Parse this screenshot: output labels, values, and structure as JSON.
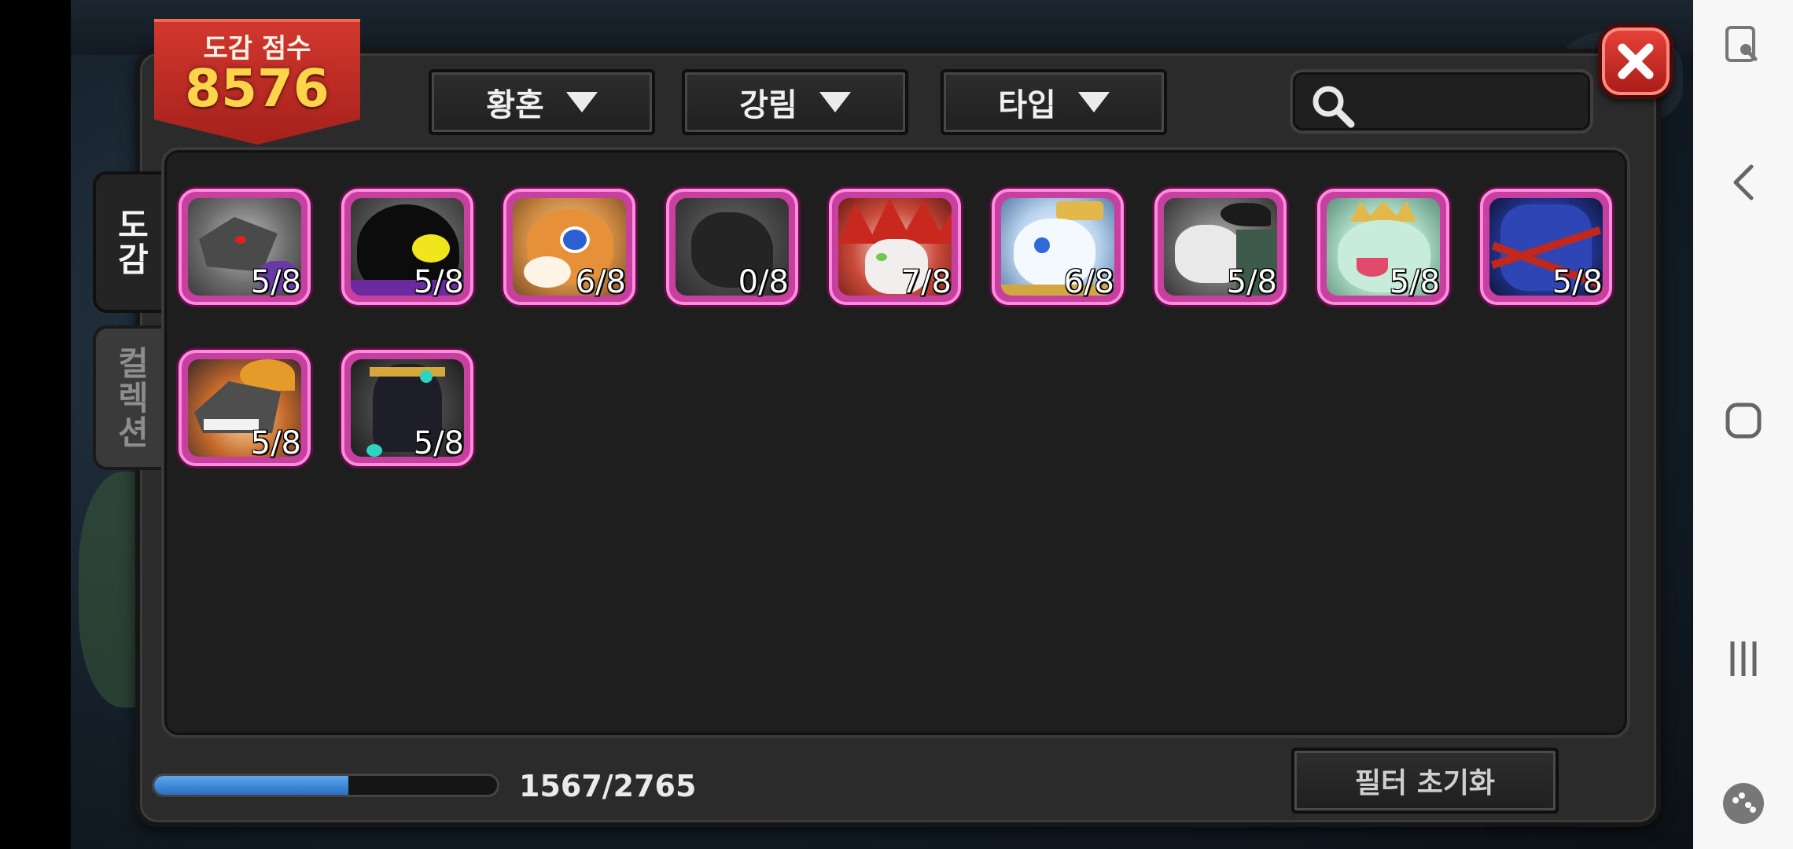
{
  "score": {
    "label": "도감 점수",
    "value": "8576"
  },
  "filters": [
    {
      "label": "황혼"
    },
    {
      "label": "강림"
    },
    {
      "label": "타입"
    }
  ],
  "search": {
    "placeholder": ""
  },
  "tabs": [
    {
      "label": "도감",
      "active": true
    },
    {
      "label": "컬렉션",
      "active": false
    }
  ],
  "monsters": [
    {
      "count": "5/8",
      "theme": "gray-dragon"
    },
    {
      "count": "5/8",
      "theme": "black-slime"
    },
    {
      "count": "6/8",
      "theme": "orange-beast"
    },
    {
      "count": "0/8",
      "theme": "locked-silhouette"
    },
    {
      "count": "7/8",
      "theme": "red-mane"
    },
    {
      "count": "6/8",
      "theme": "white-blue"
    },
    {
      "count": "5/8",
      "theme": "skull-horn"
    },
    {
      "count": "5/8",
      "theme": "teal-crown"
    },
    {
      "count": "5/8",
      "theme": "blue-armored"
    },
    {
      "count": "5/8",
      "theme": "gold-horn-dragon"
    },
    {
      "count": "5/8",
      "theme": "dark-jackal"
    }
  ],
  "progress": {
    "text": "1567/2765",
    "fraction": 0.5667
  },
  "reset_button": {
    "label": "필터 초기화"
  },
  "colors": {
    "card_frame": "#c73f9f",
    "score_ribbon": "#c22c24",
    "score_text": "#ffd44a",
    "progress_fill": "#3f89da"
  },
  "system_nav": {
    "icons": [
      "screen-touch-icon",
      "back-icon",
      "home-icon",
      "recents-icon",
      "game-tools-icon"
    ]
  }
}
